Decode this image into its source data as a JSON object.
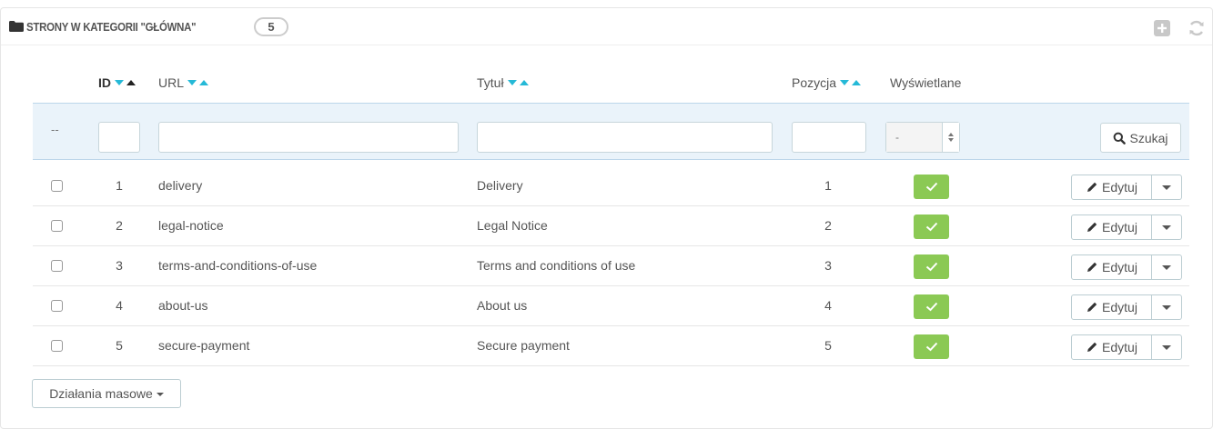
{
  "panel": {
    "title": "Strony w kategorii \"Główna\"",
    "count": "5",
    "icons": {
      "heading": "folder-icon",
      "add": "add-new-icon",
      "refresh": "refresh-icon"
    }
  },
  "columns": {
    "id": "ID",
    "url": "URL",
    "title": "Tytuł",
    "position": "Pozycja",
    "displayed": "Wyświetlane"
  },
  "filters": {
    "bulk_placeholder": "--",
    "displayed_selected": "-",
    "search_label": "Szukaj"
  },
  "rows": [
    {
      "id": "1",
      "url": "delivery",
      "title": "Delivery",
      "position": "1",
      "displayed": true,
      "edit_label": "Edytuj"
    },
    {
      "id": "2",
      "url": "legal-notice",
      "title": "Legal Notice",
      "position": "2",
      "displayed": true,
      "edit_label": "Edytuj"
    },
    {
      "id": "3",
      "url": "terms-and-conditions-of-use",
      "title": "Terms and conditions of use",
      "position": "3",
      "displayed": true,
      "edit_label": "Edytuj"
    },
    {
      "id": "4",
      "url": "about-us",
      "title": "About us",
      "position": "4",
      "displayed": true,
      "edit_label": "Edytuj"
    },
    {
      "id": "5",
      "url": "secure-payment",
      "title": "Secure payment",
      "position": "5",
      "displayed": true,
      "edit_label": "Edytuj"
    }
  ],
  "bulk_actions": {
    "label": "Działania masowe"
  },
  "colors": {
    "accent": "#25b9d7",
    "active_green": "#8bc954",
    "filter_bg": "#eaf3fa"
  }
}
